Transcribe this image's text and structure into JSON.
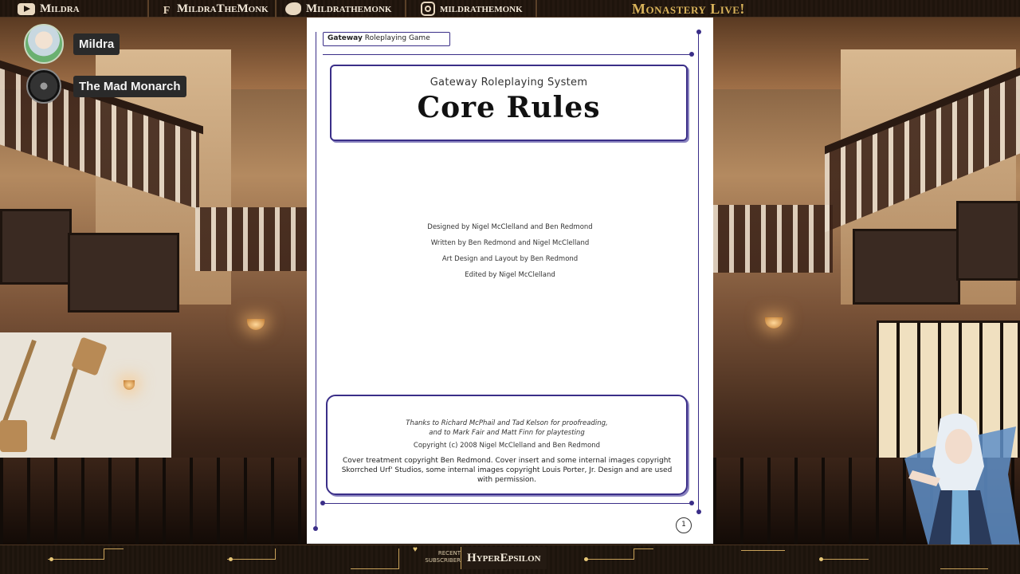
{
  "topbar": {
    "youtube_name": "Mildra",
    "facebook_name": "MildraTheMonk",
    "twitter_name": "Mildrathemonk",
    "instagram_name": "mildrathemonk",
    "stream_title": "Monastery Live!"
  },
  "hosts": [
    {
      "name": "Mildra"
    },
    {
      "name": "The Mad Monarch"
    }
  ],
  "document": {
    "header_bold": "Gateway",
    "header_rest": " Roleplaying Game",
    "title_kicker": "Gateway Roleplaying System",
    "title_main": "Core Rules",
    "credits": [
      "Designed by Nigel McClelland and Ben Redmond",
      "Written by Ben Redmond and Nigel McClelland",
      "Art Design and Layout by Ben Redmond",
      "Edited by Nigel McClelland"
    ],
    "thanks_line1": "Thanks to Richard McPhail and Tad Kelson for proofreading,",
    "thanks_line2": "and to Mark Fair and Matt Finn for playtesting",
    "copyright": "Copyright (c) 2008 Nigel McClelland and Ben Redmond",
    "cover_notice": "Cover treatment copyright Ben Redmond. Cover insert and some internal images copyright Skorrched Urf' Studios, some internal images copyright Louis Porter, Jr. Design and are used with permission.",
    "page_number": "1"
  },
  "bottombar": {
    "recent_label_line1": "RECENT",
    "recent_label_line2": "SUBSCRIBER",
    "recent_name": "HyperEpsilon"
  },
  "icons": [
    "youtube-icon",
    "facebook-icon",
    "twitter-icon",
    "instagram-icon",
    "heart-icon"
  ],
  "colors": {
    "accent_gold": "#d9b35a",
    "doc_border": "#3a2e88"
  }
}
